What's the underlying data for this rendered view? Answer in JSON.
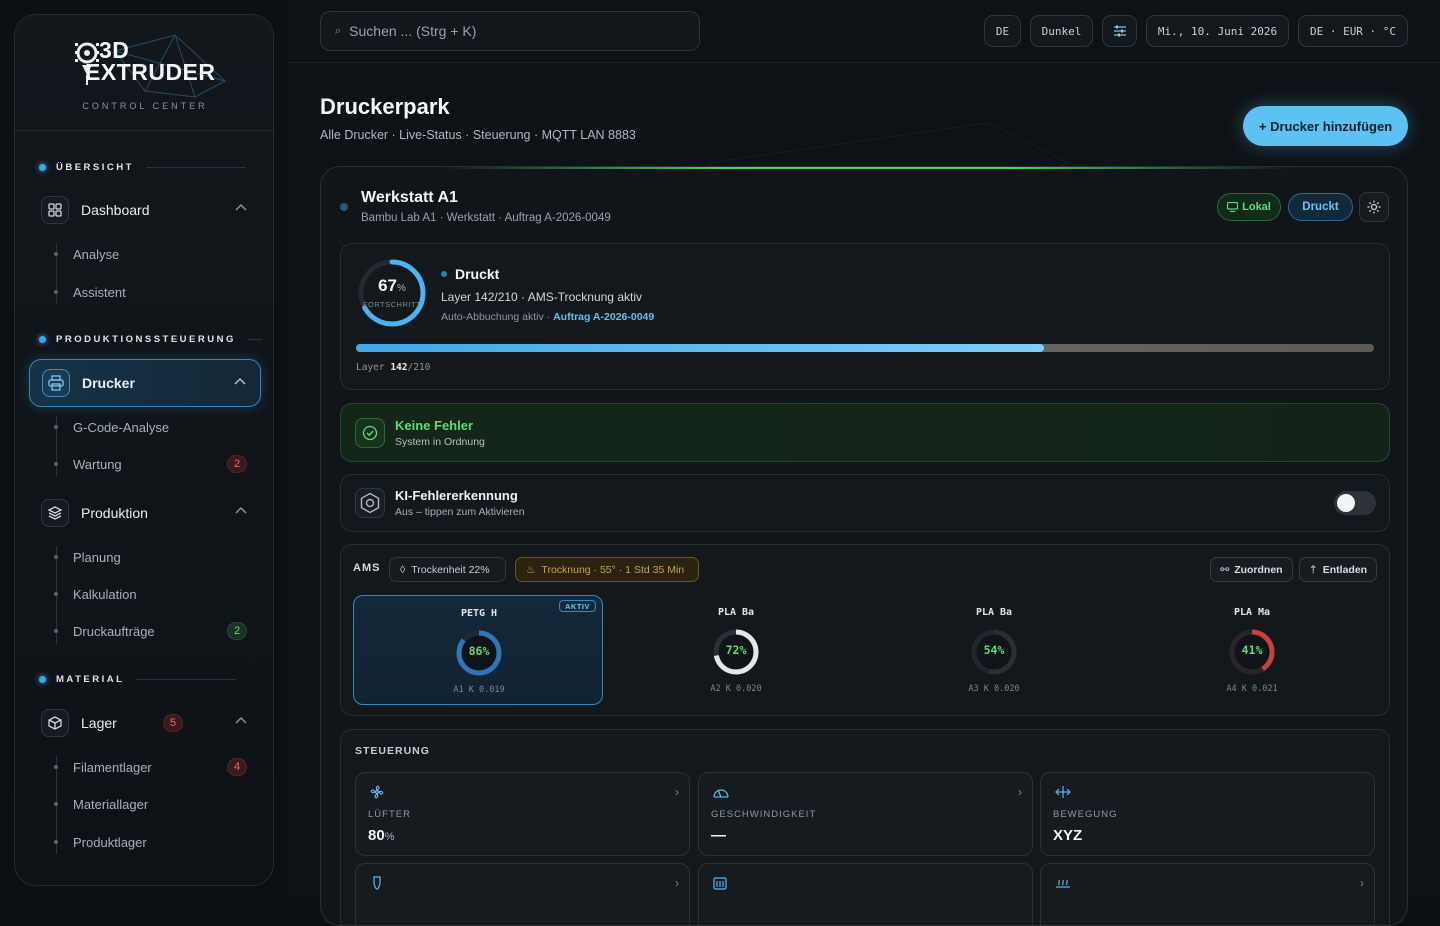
{
  "brand": {
    "line1": "3D",
    "line2": "EXTRUDER",
    "tagline": "CONTROL CENTER"
  },
  "sidebar": {
    "sections": [
      {
        "label": "ÜBERSICHT"
      },
      {
        "label": "PRODUKTIONSSTEUERUNG"
      },
      {
        "label": "MATERIAL"
      }
    ],
    "dashboard": {
      "label": "Dashboard",
      "children": [
        "Analyse",
        "Assistent"
      ]
    },
    "drucker": {
      "label": "Drucker",
      "children": [
        "G-Code-Analyse",
        "Wartung"
      ],
      "wartung_badge": "2"
    },
    "produktion": {
      "label": "Produktion",
      "children": [
        "Planung",
        "Kalkulation",
        "Druckaufträge"
      ],
      "auftraege_badge": "2"
    },
    "lager": {
      "label": "Lager",
      "badge": "5",
      "children": [
        "Filamentlager",
        "Materiallager",
        "Produktlager"
      ],
      "filament_badge": "4"
    }
  },
  "topbar": {
    "search_placeholder": "Suchen ... (Strg + K)",
    "lang": "DE",
    "theme": "Dunkel",
    "date": "Mi., 10. Juni 2026",
    "locale": "DE · EUR · °C"
  },
  "page": {
    "title": "Druckerpark",
    "subtitle": "Alle Drucker · Live-Status · Steuerung · MQTT LAN 8883",
    "add_button": "+ Drucker hinzufügen"
  },
  "printer": {
    "name": "Werkstatt A1",
    "meta": "Bambu Lab A1 · Werkstatt · Auftrag A-2026-0049",
    "badge_local": "Lokal",
    "badge_state": "Druckt",
    "progress": {
      "percent": "67",
      "unit": "%",
      "label": "FORTSCHRITT",
      "value": 0.67,
      "state": "Druckt",
      "layer_text": "Layer 142/210 · AMS-Trocknung aktiv",
      "auto_text": "Auto-Abbuchung aktiv · ",
      "order": "Auftrag A-2026-0049",
      "bar_label": "Layer",
      "layer_cur": "142",
      "layer_total": "/210",
      "layer_fraction": 0.676
    },
    "ok": {
      "title": "Keine Fehler",
      "text": "System in Ordnung"
    },
    "ki": {
      "title": "KI-Fehlererkennung",
      "text": "Aus – tippen zum Aktivieren",
      "enabled": false
    },
    "ams": {
      "title": "AMS",
      "dryness": "Trockenheit 22%",
      "drying": "Trocknung · 55° · 1 Std 35 Min",
      "assign": "Zuordnen",
      "unload": "Entladen",
      "slots": [
        {
          "name": "PETG H",
          "pct": "86%",
          "value": 0.86,
          "k": "A1 K 0.019",
          "active": "AKTIV",
          "color": "#2f76b8"
        },
        {
          "name": "PLA Ba",
          "pct": "72%",
          "value": 0.72,
          "k": "A2 K 0.020",
          "color": "#e6e6e6"
        },
        {
          "name": "PLA Ba",
          "pct": "54%",
          "value": 0.54,
          "k": "A3 K 0.020",
          "color": "#2a2f34"
        },
        {
          "name": "PLA Ma",
          "pct": "41%",
          "value": 0.41,
          "k": "A4 K 0.021",
          "color": "#c8413a"
        }
      ]
    },
    "control": {
      "title": "STEUERUNG",
      "fan": {
        "label": "LÜFTER",
        "value": "80",
        "unit": "%"
      },
      "speed": {
        "label": "GESCHWINDIGKEIT",
        "value": "—"
      },
      "move": {
        "label": "BEWEGUNG",
        "value": "XYZ"
      }
    }
  },
  "colors": {
    "accent": "#3ea8e6",
    "success": "#5fd97a",
    "danger": "#ef6b6b",
    "warning": "#c9a44a"
  }
}
